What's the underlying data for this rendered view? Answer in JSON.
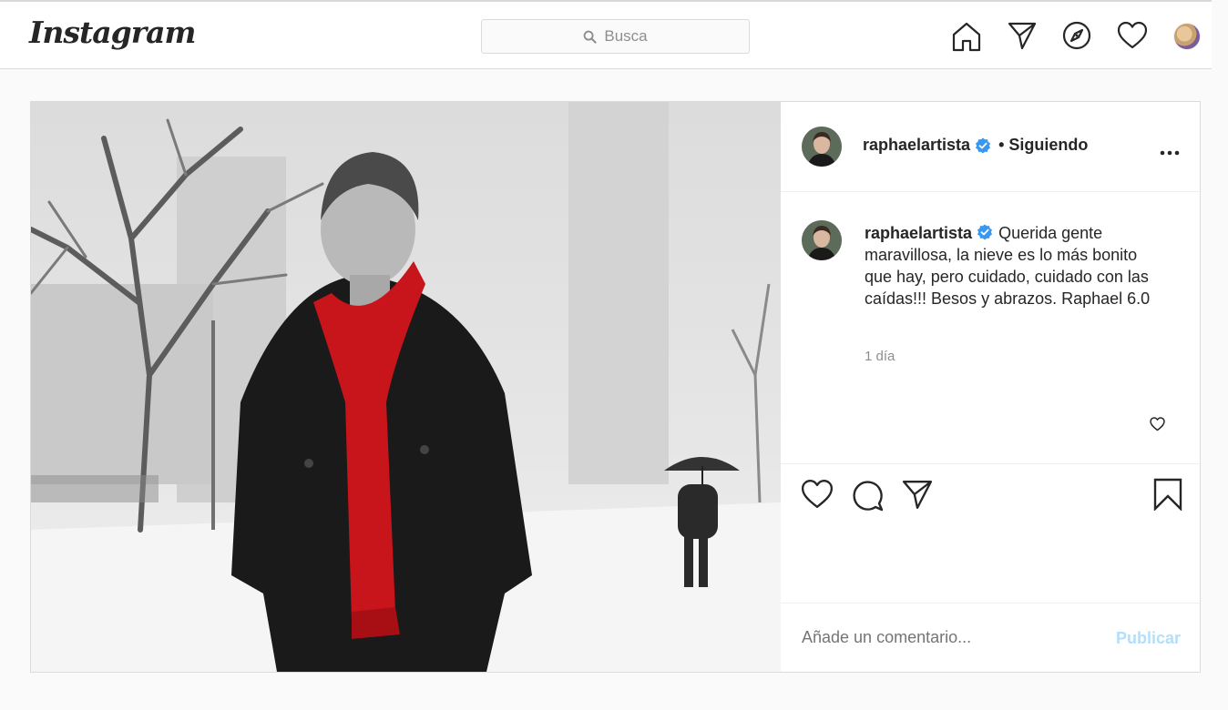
{
  "header": {
    "logo": "Instagram",
    "search": {
      "placeholder": "Busca"
    }
  },
  "post": {
    "author": {
      "username": "raphaelartista",
      "verified": true
    },
    "follow_status": "• Siguiendo",
    "caption": "Querida gente maravillosa, la nieve es lo más bonito que hay, pero cuidado, cuidado con las caídas!!! Besos y abrazos. Raphael 6.0",
    "time_ago": "1 día",
    "comment_placeholder": "Añade un comentario...",
    "publish_label": "Publicar"
  },
  "colors": {
    "verified_blue": "#3897f0",
    "scarf_red": "#c8141b",
    "publish_disabled": "#b2dffc"
  }
}
